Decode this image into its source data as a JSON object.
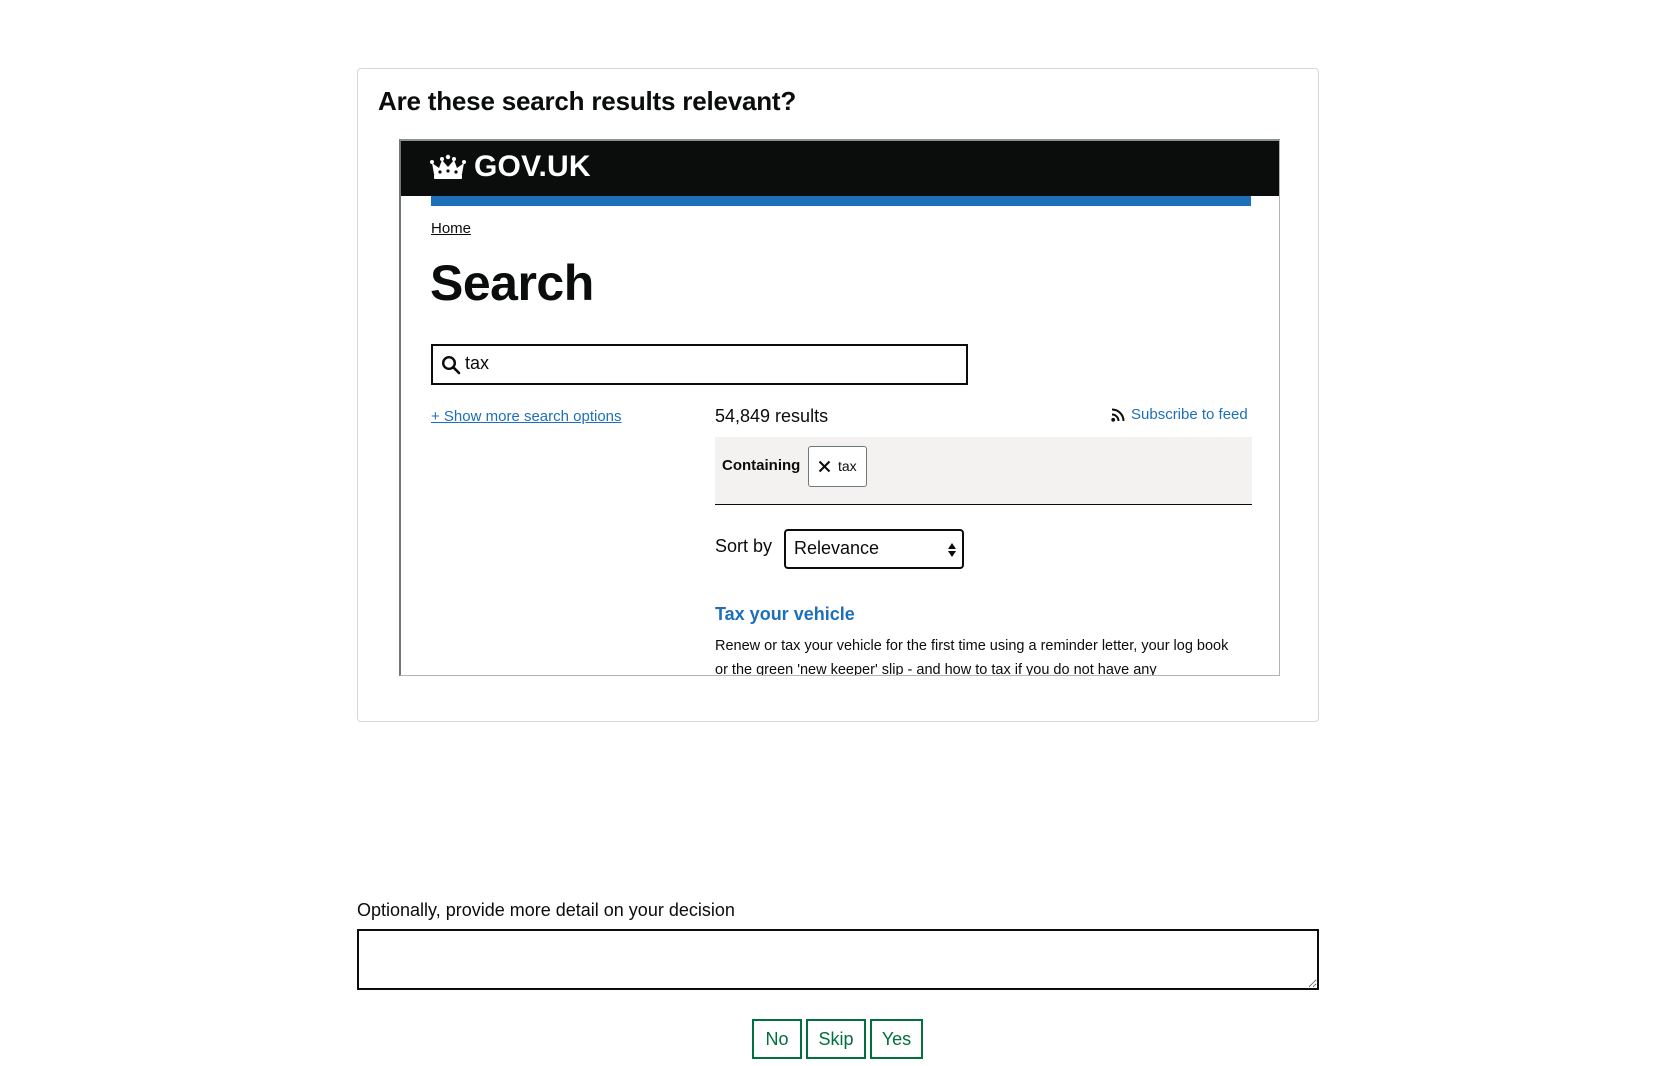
{
  "question": "Are these search results relevant?",
  "preview": {
    "header": {
      "logo_text": "GOV.UK"
    },
    "breadcrumb": {
      "home": "Home"
    },
    "heading": "Search",
    "search": {
      "value": "tax"
    },
    "more_options": "+ Show more search options",
    "results_count": "54,849 results",
    "subscribe": "Subscribe to feed",
    "filter": {
      "label": "Containing",
      "tag": "tax"
    },
    "sort": {
      "label": "Sort by",
      "value": "Relevance"
    },
    "results": [
      {
        "title": "Tax your vehicle",
        "description": "Renew or tax your vehicle for the first time using a reminder letter, your log book or the green 'new keeper' slip - and how to tax if you do not have any"
      }
    ]
  },
  "feedback": {
    "label": "Optionally, provide more detail on your decision",
    "value": ""
  },
  "buttons": {
    "no": "No",
    "skip": "Skip",
    "yes": "Yes"
  },
  "colors": {
    "gov_black": "#0b0c0c",
    "gov_blue": "#1d70b8",
    "button_green": "#00703c",
    "panel_grey": "#f3f2f1"
  }
}
